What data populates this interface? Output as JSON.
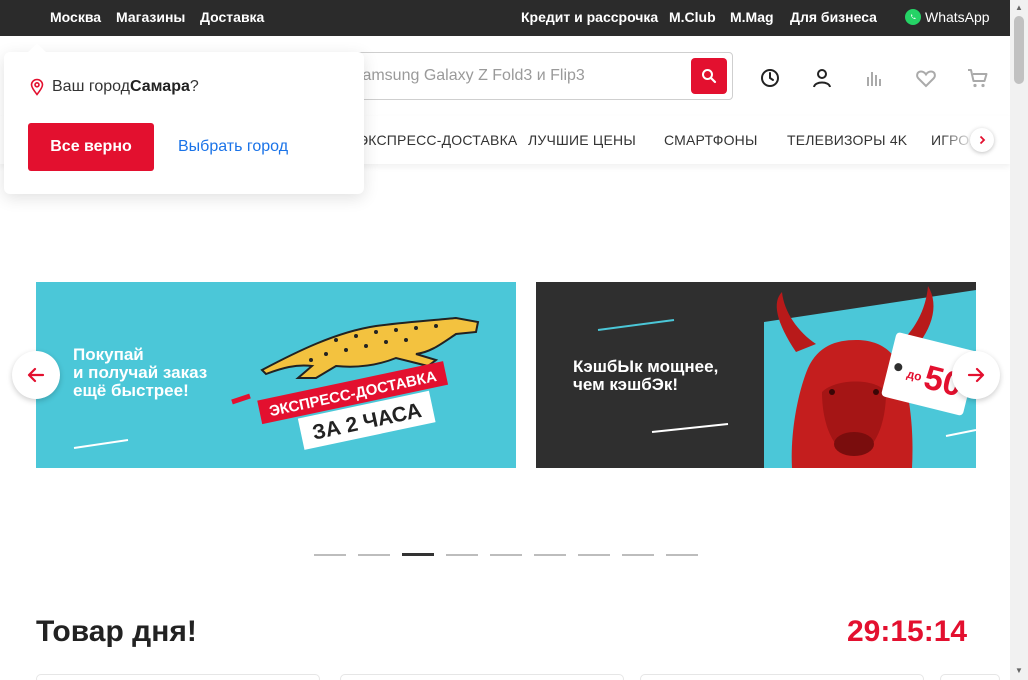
{
  "topbar": {
    "left_links": [
      "Москва",
      "Магазины",
      "Доставка"
    ],
    "right_links": [
      "Кредит и рассрочка",
      "M.Club",
      "M.Mag",
      "Для бизнеса"
    ],
    "whatsapp": "WhatsApp"
  },
  "search": {
    "placeholder": "ь Samsung Galaxy Z Fold3 и Flip3"
  },
  "header_icons": [
    "history-icon",
    "user-icon",
    "compare-icon",
    "heart-icon",
    "cart-icon"
  ],
  "nav": {
    "items": [
      "ЭКСПРЕСС-ДОСТАВКА",
      "ЛУЧШИЕ ЦЕНЫ",
      "СМАРТФОНЫ",
      "ТЕЛЕВИЗОРЫ 4K",
      "ИГРОВ"
    ]
  },
  "city_popup": {
    "question_prefix": "Ваш город ",
    "city": "Самара",
    "question_suffix": "?",
    "confirm": "Все верно",
    "choose": "Выбрать город"
  },
  "banners": [
    {
      "text": "Покупай\nи получай заказ\nещё быстрее!",
      "badge_top": "ЭКСПРЕСС-ДОСТАВКА",
      "badge_bottom": "ЗА 2 ЧАСА",
      "bg": "#4bc7d8"
    },
    {
      "text": "КэшбЫк мощнее,\nчем кэшбЭк!",
      "tag_prefix": "до",
      "tag_value": "50",
      "bg": "#2f2f2f"
    }
  ],
  "carousel": {
    "count": 9,
    "active": 3
  },
  "deal": {
    "title": "Товар дня!",
    "timer": "29:15:14"
  },
  "colors": {
    "accent": "#e3102f",
    "link": "#1a73e8",
    "topbar": "#2b2b2b"
  }
}
